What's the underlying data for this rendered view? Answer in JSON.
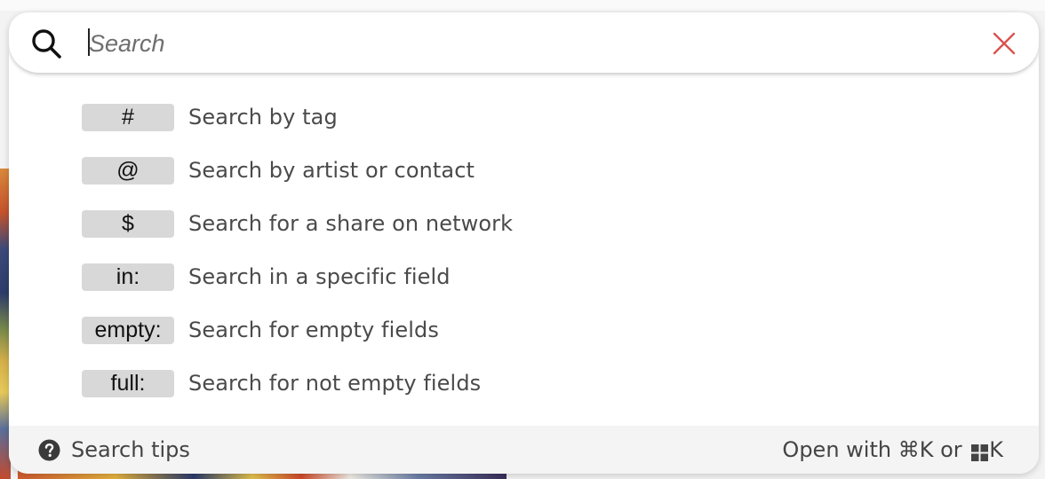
{
  "search": {
    "placeholder": "Search",
    "value": ""
  },
  "hints": [
    {
      "key": "#",
      "text": "Search by tag"
    },
    {
      "key": "@",
      "text": "Search by artist or contact"
    },
    {
      "key": "$",
      "text": "Search for a share on network"
    },
    {
      "key": "in:",
      "text": "Search in a specific field"
    },
    {
      "key": "empty:",
      "text": "Search for empty fields"
    },
    {
      "key": "full:",
      "text": "Search for not empty fields"
    }
  ],
  "footer": {
    "tips_label": "Search tips",
    "shortcut_prefix": "Open with ⌘K or ",
    "shortcut_suffix": "K"
  },
  "icons": {
    "search": "search-icon",
    "close": "close-icon",
    "help": "question-circle-icon",
    "windows": "windows-key-icon"
  },
  "colors": {
    "close_accent": "#d9534f",
    "key_background": "#d8d8d8",
    "footer_background": "#f4f4f4"
  }
}
